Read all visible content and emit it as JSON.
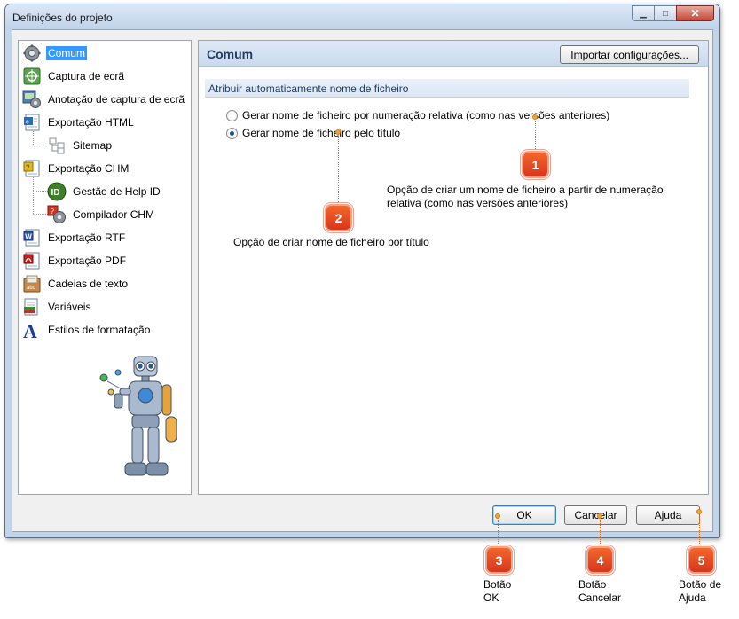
{
  "window": {
    "title": "Definições do projeto",
    "controls": {
      "minimize": "▁",
      "maximize": "□",
      "close": "✕"
    }
  },
  "sidebar": {
    "items": [
      {
        "label": "Comum",
        "icon": "gear-icon",
        "selected": true
      },
      {
        "label": "Captura de ecrã",
        "icon": "screen-capture-icon"
      },
      {
        "label": "Anotação de captura de ecrã",
        "icon": "annotation-icon"
      },
      {
        "label": "Exportação HTML",
        "icon": "html-export-icon"
      },
      {
        "label": "Sitemap",
        "icon": "sitemap-icon"
      },
      {
        "label": "Exportação CHM",
        "icon": "chm-export-icon"
      },
      {
        "label": "Gestão de Help ID",
        "icon": "help-id-icon"
      },
      {
        "label": "Compilador CHM",
        "icon": "chm-compiler-icon"
      },
      {
        "label": "Exportação RTF",
        "icon": "rtf-export-icon"
      },
      {
        "label": "Exportação PDF",
        "icon": "pdf-export-icon"
      },
      {
        "label": "Cadeias de texto",
        "icon": "text-strings-icon"
      },
      {
        "label": "Variáveis",
        "icon": "variables-icon"
      },
      {
        "label": "Estilos de formatação",
        "icon": "formatting-styles-icon"
      }
    ]
  },
  "content": {
    "title": "Comum",
    "import_button": "Importar configurações...",
    "section_title": "Atribuir automaticamente nome de ficheiro",
    "options": [
      {
        "label": "Gerar nome de ficheiro por numeração relativa (como nas versões anteriores)",
        "checked": false
      },
      {
        "label": "Gerar nome de ficheiro pelo título",
        "checked": true
      }
    ]
  },
  "buttons": {
    "ok": "OK",
    "cancel": "Cancelar",
    "help": "Ajuda"
  },
  "callouts": [
    {
      "number": "1",
      "text": "Opção de criar um nome de ficheiro a partir de numeração relativa (como nas versões anteriores)"
    },
    {
      "number": "2",
      "text": "Opção de criar nome de ficheiro por título"
    },
    {
      "number": "3",
      "text": "Botão OK"
    },
    {
      "number": "4",
      "text": "Botão Cancelar"
    },
    {
      "number": "5",
      "text": "Botão de Ajuda"
    }
  ],
  "colors": {
    "accent": "#3399ff",
    "badge": "#e8481f",
    "title_blue": "#1f3c66"
  }
}
